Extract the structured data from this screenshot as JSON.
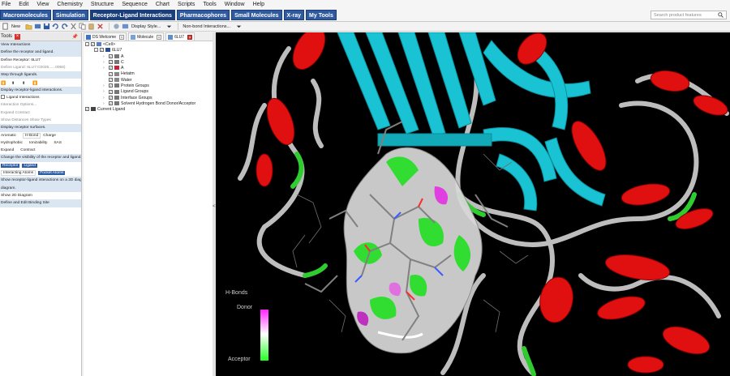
{
  "menu": [
    "File",
    "Edit",
    "View",
    "Chemistry",
    "Structure",
    "Sequence",
    "Chart",
    "Scripts",
    "Tools",
    "Window",
    "Help"
  ],
  "tabs": [
    {
      "label": "Macromolecules",
      "active": false
    },
    {
      "label": "Simulation",
      "active": false
    },
    {
      "label": "Receptor-Ligand Interactions",
      "active": true
    },
    {
      "label": "Pharmacophores",
      "active": false
    },
    {
      "label": "Small Molecules",
      "active": false
    },
    {
      "label": "X-ray",
      "active": false
    },
    {
      "label": "My Tools",
      "active": false
    }
  ],
  "search": {
    "placeholder": "Search product features"
  },
  "toolbar": {
    "new_label": "New",
    "display_style_label": "Display Style...",
    "nonbond_label": "Non-bond Interactions..."
  },
  "tools_panel": {
    "title": "Tools",
    "rows": [
      {
        "text": "View Interactions",
        "style": "hdr"
      },
      {
        "text": "Define the receptor and ligand.",
        "style": "hdr"
      },
      {
        "text": "Define Receptor: 6LU7",
        "style": "plain"
      },
      {
        "text": "Define Ligand: 6LU7:C0025......0066)",
        "style": "dim"
      },
      {
        "text": "Step through ligands.",
        "style": "hdr"
      },
      {
        "text": "",
        "style": "icons"
      },
      {
        "text": "Display receptor-ligand interactions.",
        "style": "hdr"
      },
      {
        "text": "Ligand Interactions",
        "style": "check"
      },
      {
        "text": "Interaction Options...",
        "style": "dim"
      },
      {
        "text": "Expand      Contract",
        "style": "dim"
      },
      {
        "text": "Show Distances      Show Types",
        "style": "dim"
      },
      {
        "text": "Display receptor surfaces.",
        "style": "hdr"
      },
      {
        "text": "",
        "style": "surfaces1"
      },
      {
        "text": "",
        "style": "surfaces2"
      },
      {
        "text": "",
        "style": "expand"
      },
      {
        "text": "Change the visibility of the receptor and ligand.",
        "style": "hdr"
      },
      {
        "text": "",
        "style": "vis1"
      },
      {
        "text": "",
        "style": "vis2"
      },
      {
        "text": "Show receptor-ligand interactions on a 2D diagram.",
        "style": "hdr"
      },
      {
        "text": "",
        "style": "hdr2"
      },
      {
        "text": "Show 2D Diagram",
        "style": "plain"
      },
      {
        "text": "Define and Edit Binding Site",
        "style": "hdr"
      }
    ],
    "surface_buttons": {
      "aromatic": "Aromatic",
      "hbond": "H-Bond",
      "charge": "Charge",
      "hydrophobic": "Hydrophobic",
      "ionizability": "Ionizability",
      "sas": "SAS"
    },
    "expand": "Expand",
    "contract": "Contract",
    "vis_buttons": {
      "receptor": "Receptor",
      "ligand": "Ligand",
      "interacting_atoms": "Interacting Atoms",
      "pocket_atoms": "Pocket Atoms"
    },
    "diagram_line2": "diagram."
  },
  "doc_tabs": [
    {
      "label": "DS Welcome",
      "active": false
    },
    {
      "label": "Molecule",
      "active": false
    },
    {
      "label": "6LU7",
      "active": true
    }
  ],
  "tree": [
    {
      "label": "<Cell>",
      "indent": 0,
      "exp": "-",
      "icon": "cell"
    },
    {
      "label": "6LU7",
      "indent": 1,
      "exp": "-",
      "icon": "prot"
    },
    {
      "label": "A",
      "indent": 2,
      "arrow": true,
      "icon": "chain"
    },
    {
      "label": "C",
      "indent": 2,
      "arrow": true,
      "icon": "chain"
    },
    {
      "label": "A",
      "indent": 2,
      "arrow": true,
      "icon": "chainr"
    },
    {
      "label": "Hetatm",
      "indent": 2,
      "arrow": false,
      "icon": "het"
    },
    {
      "label": "Water",
      "indent": 2,
      "arrow": false,
      "icon": "water"
    },
    {
      "label": "Protein Groups",
      "indent": 2,
      "arrow": true,
      "icon": "group"
    },
    {
      "label": "Ligand Groups",
      "indent": 2,
      "arrow": true,
      "icon": "group"
    },
    {
      "label": "Interface Groups",
      "indent": 2,
      "arrow": true,
      "icon": "group"
    },
    {
      "label": "Solvent Hydrogen Bond Donor/Acceptor",
      "indent": 2,
      "arrow": true,
      "icon": "group"
    },
    {
      "label": "Current Ligand",
      "indent": 0,
      "exp": "",
      "icon": "lig"
    }
  ],
  "viewer": {
    "legend_title": "H-Bonds",
    "legend_top": "Donor",
    "legend_bottom": "Acceptor"
  }
}
